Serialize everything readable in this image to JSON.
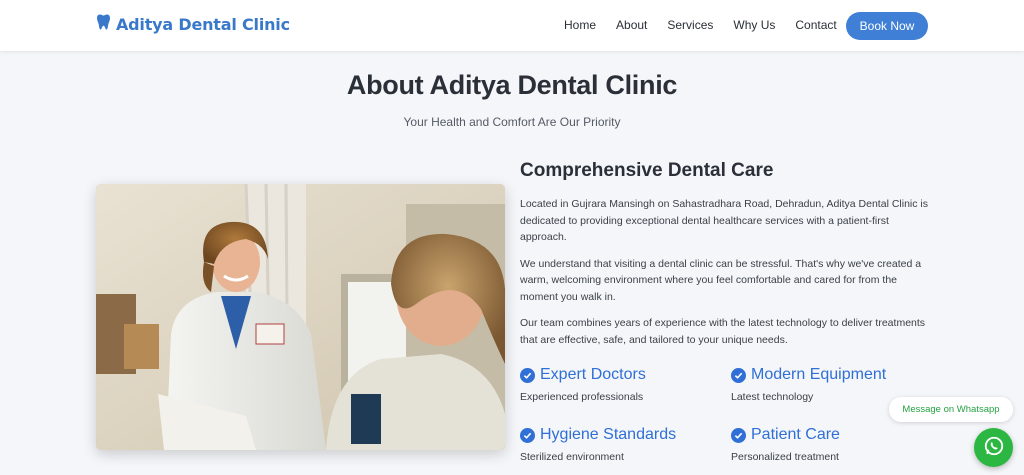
{
  "brand": {
    "name": "Aditya Dental Clinic",
    "icon": "tooth-icon",
    "color": "#3a78c9"
  },
  "nav": {
    "links": [
      "Home",
      "About",
      "Services",
      "Why Us",
      "Contact"
    ],
    "cta": "Book Now"
  },
  "hero": {
    "title": "About Aditya Dental Clinic",
    "subtitle": "Your Health and Comfort Are Our Priority"
  },
  "about": {
    "heading": "Comprehensive Dental Care",
    "paragraphs": [
      "Located in Gujrara Mansingh on Sahastradhara Road, Dehradun, Aditya Dental Clinic is dedicated to providing exceptional dental healthcare services with a patient-first approach.",
      "We understand that visiting a dental clinic can be stressful. That's why we've created a warm, welcoming environment where you feel comfortable and cared for from the moment you walk in.",
      "Our team combines years of experience with the latest technology to deliver treatments that are effective, safe, and tailored to your unique needs."
    ],
    "features": [
      {
        "title": "Expert Doctors",
        "desc": "Experienced professionals",
        "icon": "check-circle-icon"
      },
      {
        "title": "Modern Equipment",
        "desc": "Latest technology",
        "icon": "check-circle-icon"
      },
      {
        "title": "Hygiene Standards",
        "desc": "Sterilized environment",
        "icon": "check-circle-icon"
      },
      {
        "title": "Patient Care",
        "desc": "Personalized treatment",
        "icon": "check-circle-icon"
      }
    ]
  },
  "whatsapp": {
    "label": "Message on Whatsapp",
    "icon": "whatsapp-icon",
    "color": "#2bb741"
  },
  "colors": {
    "accent": "#3f7fd6",
    "feature": "#2f6fd6"
  }
}
